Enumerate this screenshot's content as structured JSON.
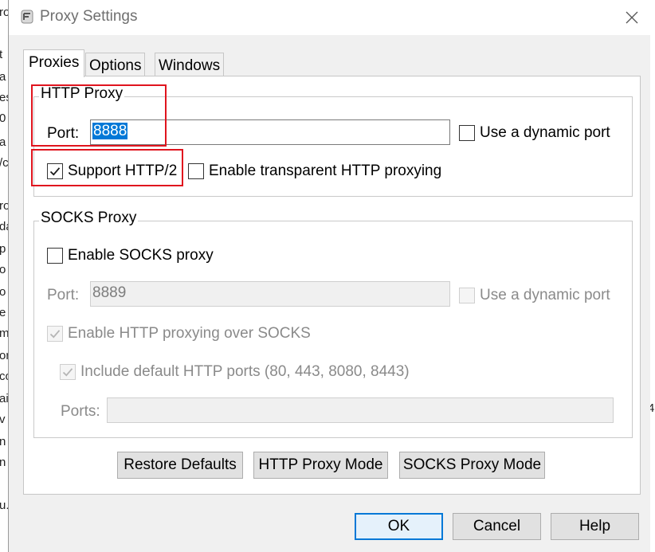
{
  "window": {
    "title": "Proxy Settings",
    "icon": "fiddler-app-icon"
  },
  "background_text": [
    "ro",
    "t",
    "a",
    "es",
    "0",
    "a",
    "/c",
    "ro",
    "da",
    "p",
    "o",
    "o",
    "e",
    "m",
    "or",
    "co",
    "ai",
    "v",
    "n",
    "n",
    "u."
  ],
  "background_right_text": "4",
  "tabs": [
    "Proxies",
    "Options",
    "Windows"
  ],
  "active_tab": "Proxies",
  "http_proxy": {
    "legend": "HTTP Proxy",
    "port_label": "Port:",
    "port_value": "8888",
    "dynamic_port_label": "Use a dynamic port",
    "dynamic_port_checked": false,
    "support_http2_label": "Support HTTP/2",
    "support_http2_checked": true,
    "transparent_label": "Enable transparent HTTP proxying",
    "transparent_checked": false
  },
  "socks_proxy": {
    "legend": "SOCKS Proxy",
    "enable_label": "Enable SOCKS proxy",
    "enable_checked": false,
    "port_label": "Port:",
    "port_value": "8889",
    "dynamic_port_label": "Use a dynamic port",
    "http_over_socks_label": "Enable HTTP proxying over SOCKS",
    "http_over_socks_checked": true,
    "include_ports_label": "Include default HTTP ports (80, 443, 8080, 8443)",
    "include_ports_checked": true,
    "ports_label": "Ports:",
    "ports_value": ""
  },
  "panel_buttons": {
    "restore": "Restore Defaults",
    "http_mode": "HTTP Proxy Mode",
    "socks_mode": "SOCKS Proxy Mode"
  },
  "dialog_buttons": {
    "ok": "OK",
    "cancel": "Cancel",
    "help": "Help"
  },
  "colors": {
    "annotation": "#e0141e",
    "selection": "#0078d7",
    "dialog_bg": "#f0f0f0"
  }
}
